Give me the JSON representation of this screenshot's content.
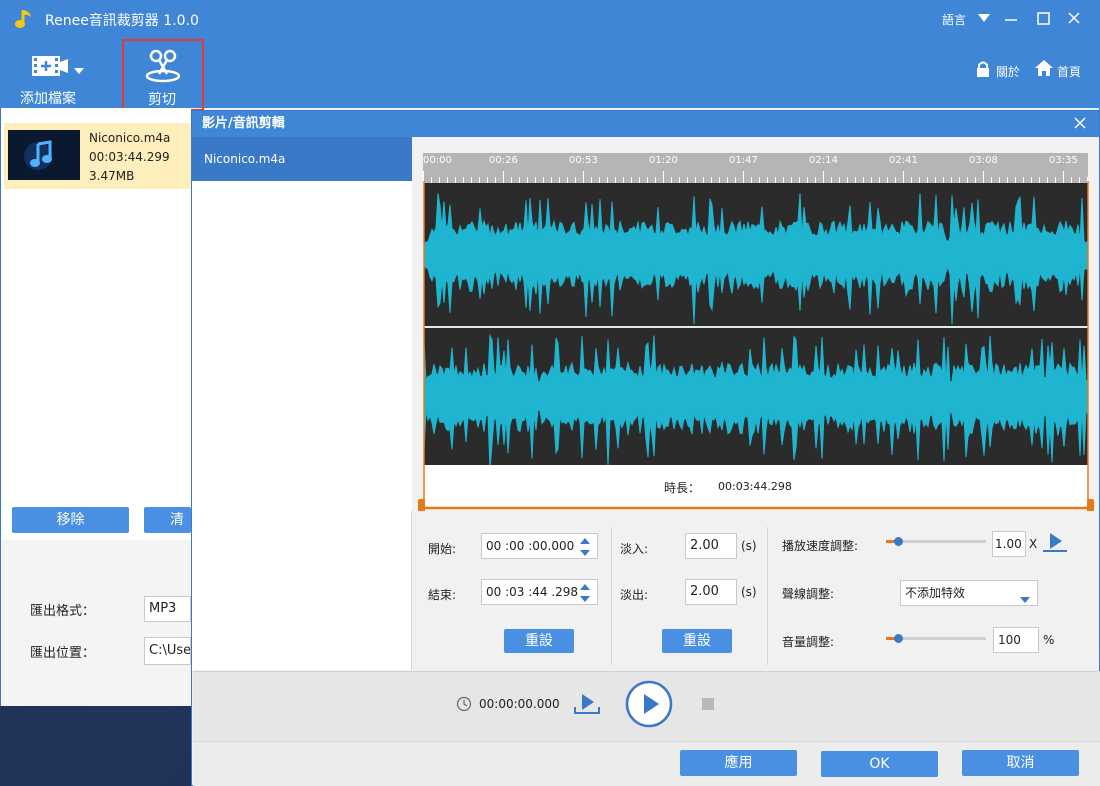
{
  "app": {
    "title": "Renee音訊裁剪器 1.0.0",
    "language_label": "語言"
  },
  "toolbar": {
    "add_file_label": "添加檔案",
    "cut_label": "剪切",
    "about_label": "關於",
    "home_label": "首頁"
  },
  "file_item": {
    "name": "Niconico.m4a",
    "duration": "00:03:44.299",
    "size": "3.47MB"
  },
  "left_buttons": {
    "remove_label": "移除",
    "second_label": "清"
  },
  "export": {
    "format_label": "匯出格式：",
    "format_value": "MP3",
    "location_label": "匯出位置：",
    "location_value": "C:\\Use"
  },
  "dialog": {
    "title": "影片/音訊剪輯",
    "list_item": "Niconico.m4a",
    "timeline_ticks": [
      "00:00",
      "00:26",
      "00:53",
      "01:20",
      "01:47",
      "02:14",
      "02:41",
      "03:08",
      "03:35"
    ],
    "duration_label": "時長：",
    "duration_value": "00:03:44.298",
    "start_label": "開始:",
    "start_value": "00 :00 :00.000",
    "end_label": "結束:",
    "end_value": "00 :03 :44 .298",
    "reset_label": "重設",
    "fade_in_label": "淡入:",
    "fade_in_value": "2.00",
    "fade_out_label": "淡出:",
    "fade_out_value": "2.00",
    "seconds_unit": "(s)",
    "speed_label": "播放速度調整:",
    "speed_value": "1.00",
    "speed_unit": "X",
    "speed_level": 0.12,
    "effect_label": "聲線調整:",
    "effect_value": "不添加特效",
    "volume_label": "音量調整:",
    "volume_value": "100",
    "volume_unit": "%",
    "volume_level": 0.12,
    "play_time": "00:00:00.000",
    "apply_label": "應用",
    "ok_label": "OK",
    "cancel_label": "取消"
  },
  "colors": {
    "title_blue": "#3f86d6",
    "button_blue": "#4a90e2",
    "wave_cyan": "#1fb4cf",
    "selection_orange": "#e67a1a",
    "highlight_red": "#e53935",
    "file_item_bg": "#fdeebb"
  },
  "icons": [
    "app-note-icon",
    "add-file-icon",
    "dropdown-arrow-icon",
    "scissors-icon",
    "lock-icon",
    "home-icon",
    "minimize-icon",
    "maximize-icon",
    "close-icon",
    "media-thumbnail-icon",
    "dialog-close-icon",
    "spin-up-icon",
    "spin-down-icon",
    "preview-speed-icon",
    "chevron-down-icon",
    "clock-icon",
    "preview-export-icon",
    "play-icon",
    "stop-icon"
  ]
}
